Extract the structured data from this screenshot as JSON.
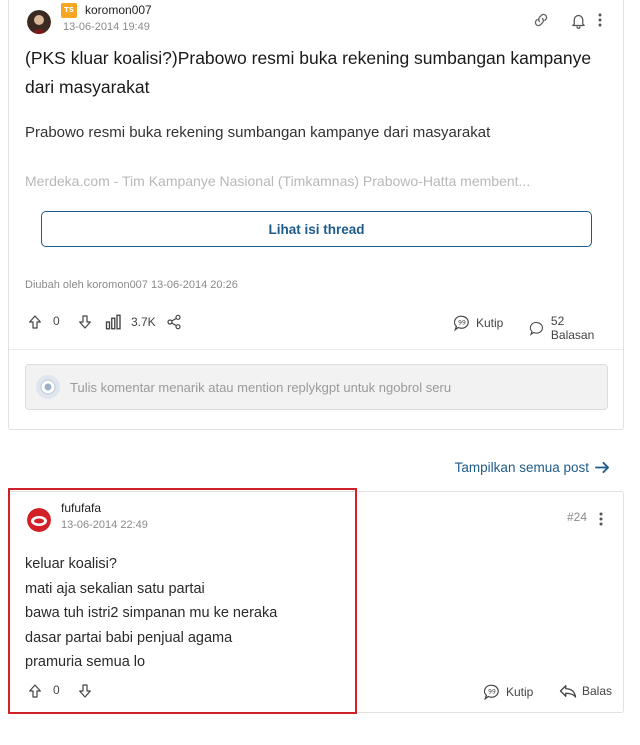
{
  "thread": {
    "author": "koromon007",
    "badge": "TS",
    "timestamp": "13-06-2014 19:49",
    "title": "(PKS kluar koalisi?)Prabowo resmi buka rekening sumbangan kampanye dari masyarakat",
    "description": "Prabowo resmi buka rekening sumbangan kampanye dari masyarakat",
    "excerpt": "Merdeka.com - Tim Kampanye Nasional (Timkamnas) Prabowo-Hatta membent...",
    "view_thread_label": "Lihat isi thread",
    "edited_note": "Diubah oleh koromon007 13-06-2014 20:26",
    "vote_count": "0",
    "views": "3.7K",
    "quote_label": "Kutip",
    "replies_label": "52 Balasan"
  },
  "comment_input": {
    "placeholder": "Tulis komentar menarik atau mention replykgpt untuk ngobrol seru"
  },
  "show_all_posts_label": "Tampilkan semua post",
  "reply": {
    "author": "fufufafa",
    "timestamp": "13-06-2014 22:49",
    "post_number": "#24",
    "lines": [
      "keluar koalisi?",
      "mati aja sekalian satu partai",
      "bawa tuh istri2 simpanan mu ke neraka",
      "dasar partai babi penjual agama",
      "pramuria semua lo"
    ],
    "vote_count": "0",
    "quote_label": "Kutip",
    "reply_label": "Balas"
  },
  "colors": {
    "accent": "#1d5b8a",
    "badge": "#f5a623",
    "highlight": "#d0202a"
  }
}
